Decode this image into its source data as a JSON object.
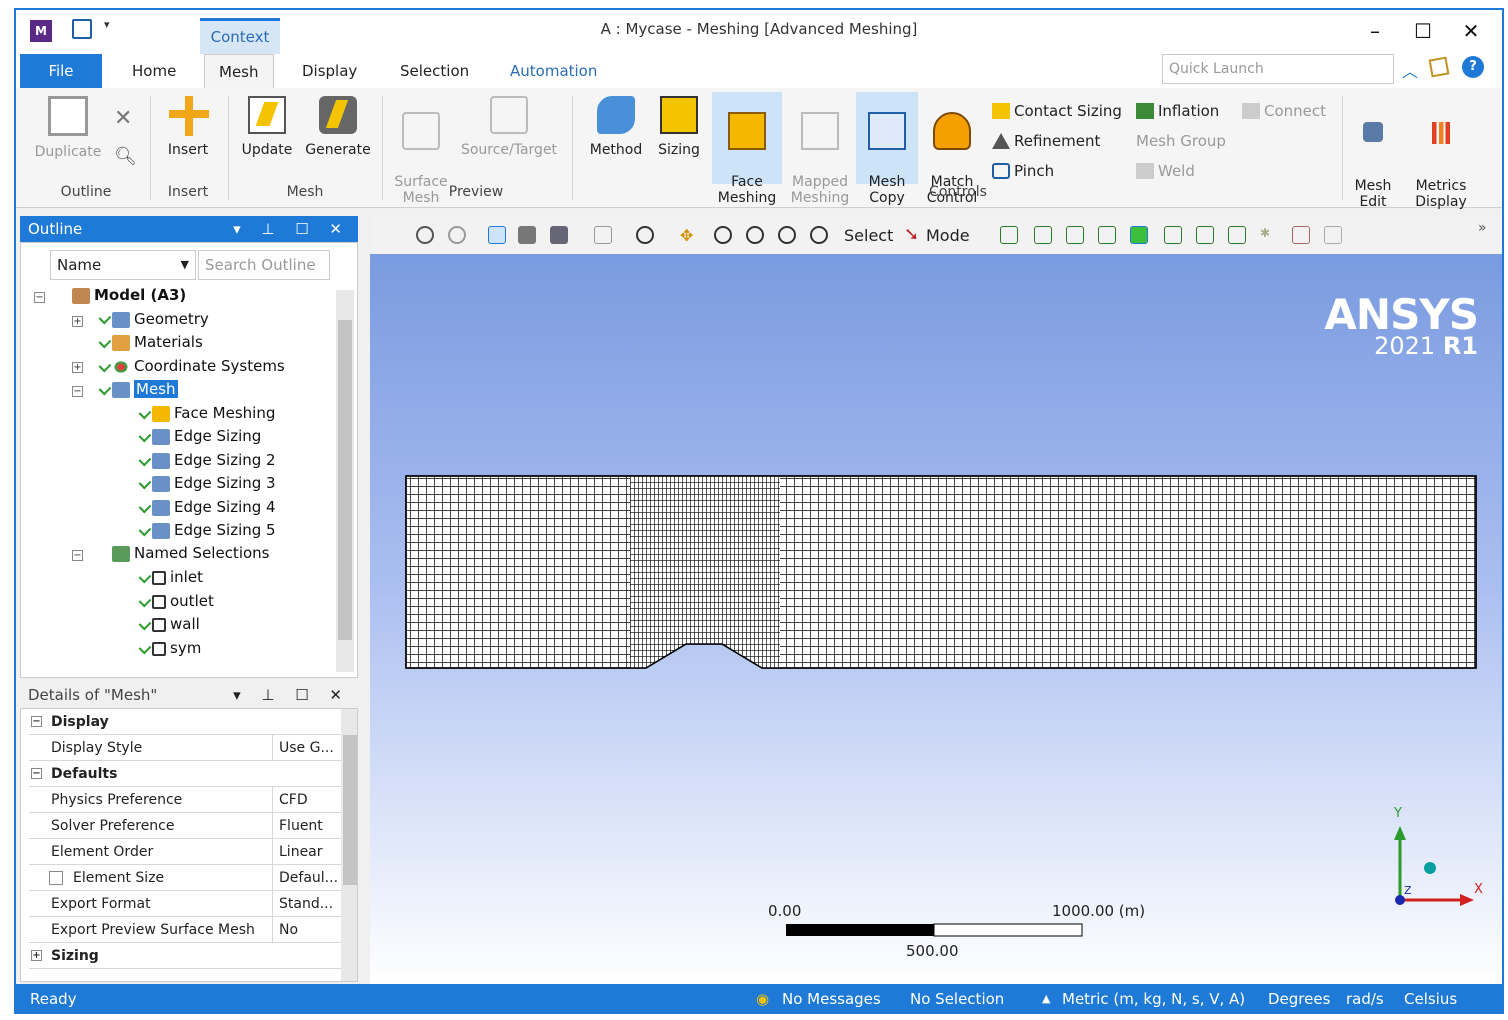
{
  "window": {
    "title": "A : Mycase - Meshing [Advanced Meshing]",
    "context_tab": "Context",
    "quick_launch_placeholder": "Quick Launch",
    "app_icon": "M"
  },
  "tabs": [
    "File",
    "Home",
    "Mesh",
    "Display",
    "Selection",
    "Automation"
  ],
  "ribbon": {
    "outline_group": {
      "duplicate": "Duplicate",
      "label": "Outline"
    },
    "insert_group": {
      "insert": "Insert",
      "label": "Insert"
    },
    "mesh_group": {
      "update": "Update",
      "generate": "Generate",
      "label": "Mesh"
    },
    "preview_group": {
      "surface_mesh": "Surface\nMesh",
      "source_target": "Source/Target",
      "label": "Preview"
    },
    "controls_group": {
      "method": "Method",
      "sizing": "Sizing",
      "face_meshing": "Face\nMeshing",
      "mapped_meshing": "Mapped\nMeshing",
      "mesh_copy": "Mesh\nCopy",
      "match_control": "Match\nControl",
      "label": "Controls",
      "contact_sizing": "Contact Sizing",
      "refinement": "Refinement",
      "pinch": "Pinch",
      "inflation": "Inflation",
      "mesh_group": "Mesh Group",
      "weld": "Weld",
      "connect": "Connect"
    },
    "mesh_edit": "Mesh\nEdit",
    "metrics_display": "Metrics\nDisplay"
  },
  "outline": {
    "title": "Outline",
    "filter_label": "Name",
    "search_placeholder": "Search Outline",
    "root": "Model (A3)",
    "items": [
      "Geometry",
      "Materials",
      "Coordinate Systems",
      "Mesh"
    ],
    "mesh_children": [
      "Face Meshing",
      "Edge Sizing",
      "Edge Sizing 2",
      "Edge Sizing 3",
      "Edge Sizing 4",
      "Edge Sizing 5"
    ],
    "named_selections": "Named Selections",
    "ns_children": [
      "inlet",
      "outlet",
      "wall",
      "sym"
    ]
  },
  "details": {
    "title": "Details of \"Mesh\"",
    "rows": [
      {
        "key": "Display",
        "section": true
      },
      {
        "key": "Display Style",
        "value": "Use G..."
      },
      {
        "key": "Defaults",
        "section": true
      },
      {
        "key": "Physics Preference",
        "value": "CFD"
      },
      {
        "key": "Solver Preference",
        "value": "Fluent"
      },
      {
        "key": "Element Order",
        "value": "Linear"
      },
      {
        "key": "Element Size",
        "value": "Defaul..."
      },
      {
        "key": "Export Format",
        "value": "Stand..."
      },
      {
        "key": "Export Preview Surface Mesh",
        "value": "No"
      },
      {
        "key": "Sizing",
        "section": true
      }
    ]
  },
  "toolbar": {
    "select": "Select",
    "mode": "Mode"
  },
  "viewport": {
    "logo": "ANSYS",
    "version_a": "2021 ",
    "version_b": "R1",
    "scale_left": "0.00",
    "scale_right": "1000.00 (m)",
    "scale_mid": "500.00",
    "axis_x": "X",
    "axis_y": "Y",
    "axis_z": "Z"
  },
  "status": {
    "ready": "Ready",
    "messages": "No Messages",
    "selection": "No Selection",
    "units": "Metric (m, kg, N, s, V, A)",
    "degrees": "Degrees",
    "rads": "rad/s",
    "temp": "Celsius"
  },
  "colors": {
    "accent": "#1e7ad6",
    "check": "#2a9a2a"
  }
}
